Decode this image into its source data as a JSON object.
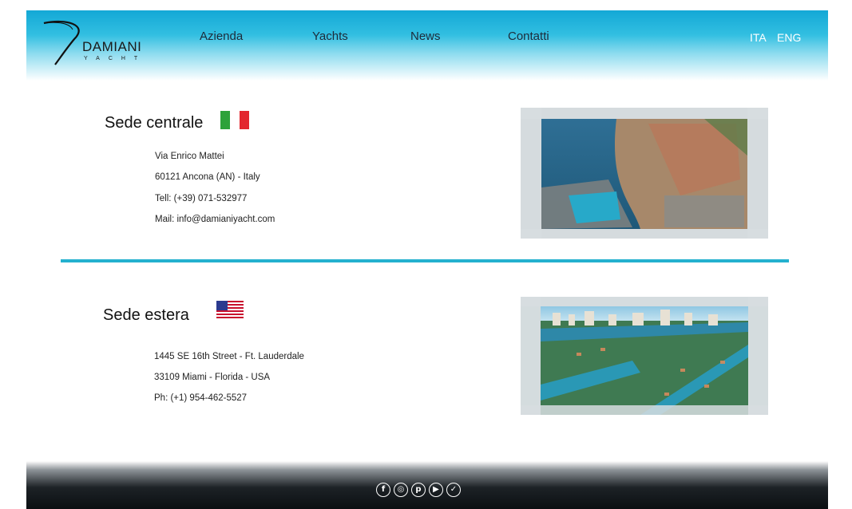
{
  "brand": {
    "name": "DAMIANI",
    "sub": "YACHT"
  },
  "nav": {
    "items": [
      "Azienda",
      "Yachts",
      "News",
      "Contatti"
    ],
    "languages": [
      "ITA",
      "ENG"
    ]
  },
  "sections": {
    "main": {
      "title": "Sede centrale",
      "lines": [
        "Via Enrico Mattei",
        "60121 Ancona (AN) - Italy",
        "Tell: (+39) 071-532977",
        "Mail: info@damianiyacht.com"
      ]
    },
    "foreign": {
      "title": "Sede estera",
      "lines": [
        "1445 SE 16th Street - Ft. Lauderdale",
        "33109 Miami - Florida - USA",
        "Ph: (+1) 954-462-5527"
      ]
    }
  },
  "footer": {
    "social": [
      {
        "name": "facebook",
        "glyph": "f"
      },
      {
        "name": "instagram",
        "glyph": "◎"
      },
      {
        "name": "pinterest",
        "glyph": "p"
      },
      {
        "name": "youtube",
        "glyph": "▶"
      },
      {
        "name": "twitter",
        "glyph": "✓"
      }
    ]
  },
  "colors": {
    "header_top": "#13a8d6",
    "divider": "#24b1cf",
    "flag_it": [
      "#2da23a",
      "#ffffff",
      "#e3262e"
    ]
  }
}
